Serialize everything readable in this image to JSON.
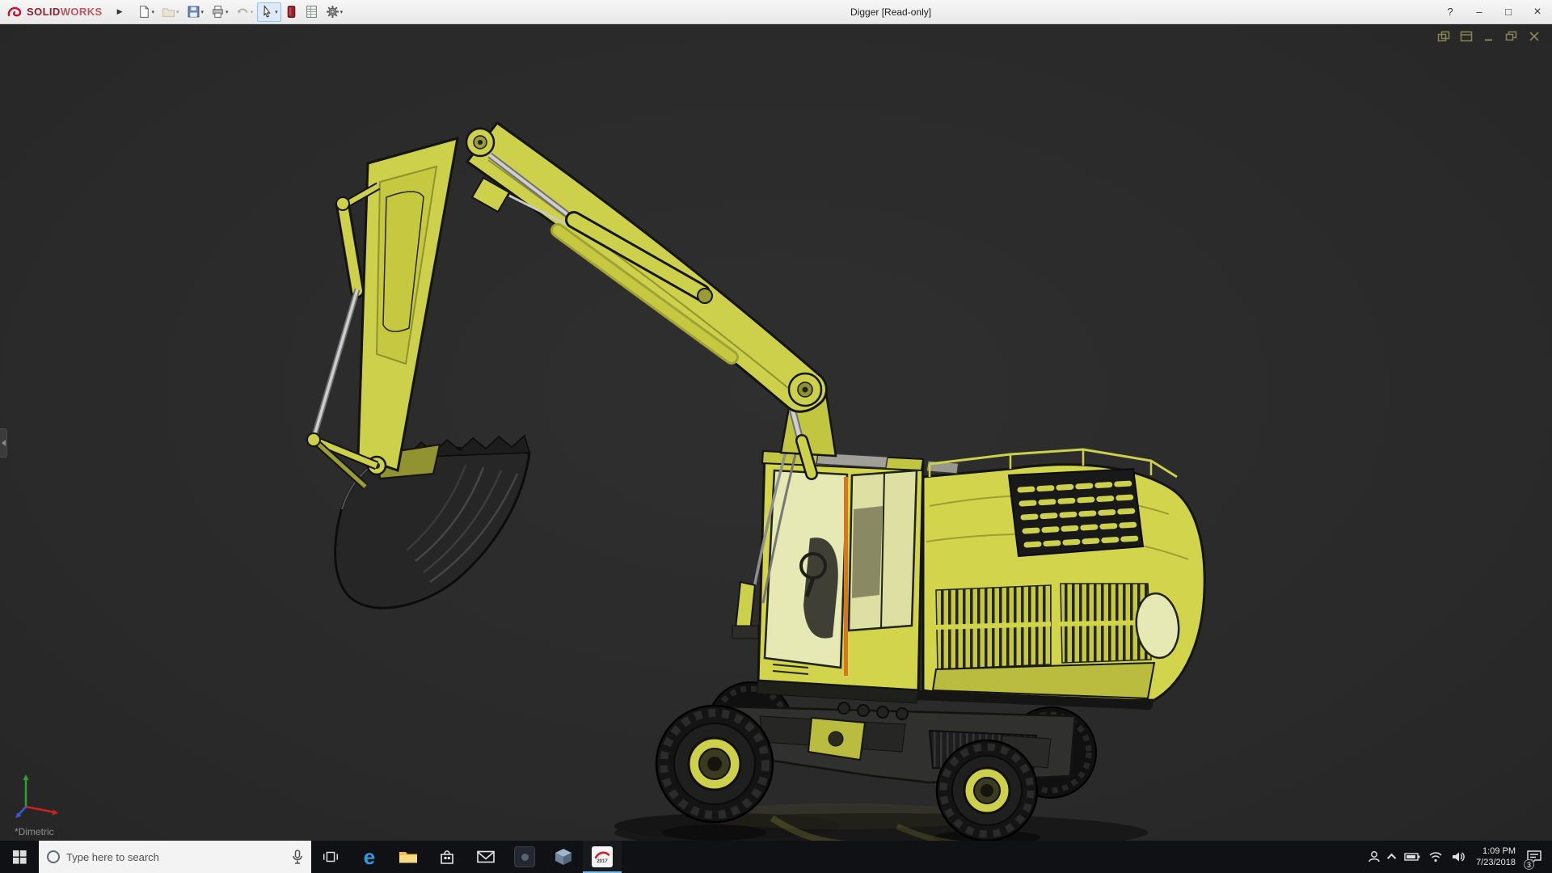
{
  "titlebar": {
    "brand_solid": "SOLID",
    "brand_works": "WORKS",
    "flyout_glyph": "▶",
    "dropdown_glyph": "▾",
    "title": "Digger [Read-only]",
    "help_glyph": "?",
    "min_glyph": "–",
    "max_glyph": "□",
    "close_glyph": "×"
  },
  "viewport": {
    "view_label": "*Dimetric"
  },
  "taskbar": {
    "search_placeholder": "Type here to search",
    "edge_glyph": "e",
    "sw_year": "2017",
    "clock_time": "1:09 PM",
    "clock_date": "7/23/2018",
    "notification_badge": "3"
  }
}
